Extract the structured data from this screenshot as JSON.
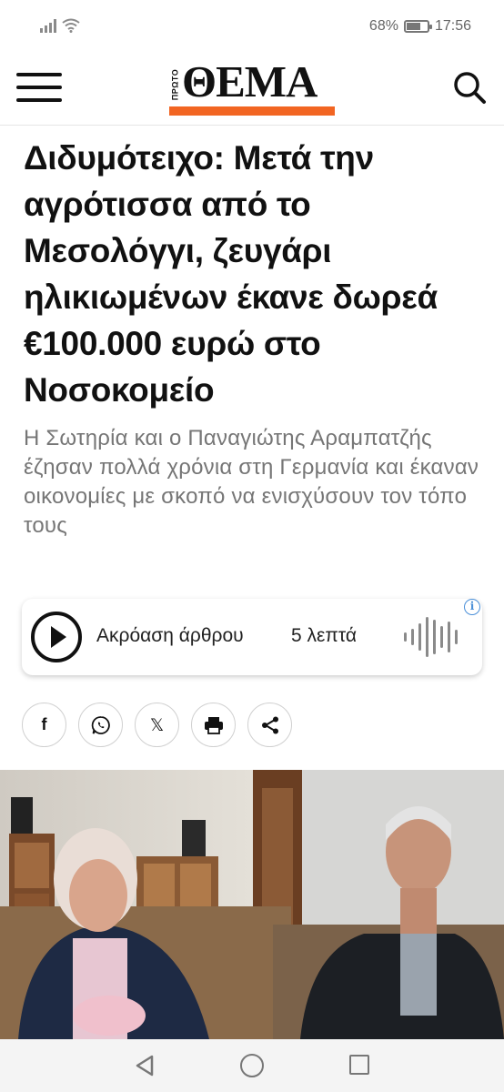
{
  "status_bar": {
    "battery_percent": "68%",
    "battery_level": 0.68,
    "time": "17:56",
    "icons": [
      "signal-icon",
      "wifi-icon",
      "battery-icon"
    ]
  },
  "header": {
    "logo_proto": "ΠΡΩΤΟ",
    "logo_text": "ΘΕΜΑ",
    "logo_accent": "#f26522",
    "icons": [
      "menu-icon",
      "search-icon"
    ]
  },
  "article": {
    "headline": "Διδυμότειχο: Μετά την αγρότισσα από το Μεσολόγγι, ζευγάρι ηλικιωμένων έκανε δωρεά €100.000 ευρώ στο Νοσοκομείο",
    "subheadline": "Η Σωτηρία και ο Παναγιώτης Αραμπατζής έζησαν πολλά χρόνια στη Γερμανία και έκαναν οικονομίες με σκοπό να ενισχύσουν τον τόπο τους"
  },
  "audio": {
    "label": "Ακρόαση άρθρου",
    "duration": "5 λεπτά",
    "info_symbol": "i",
    "icons": [
      "play-icon",
      "waveform-icon",
      "info-icon"
    ]
  },
  "share": {
    "buttons": [
      {
        "name": "facebook",
        "icon": "facebook-icon",
        "glyph": "f"
      },
      {
        "name": "whatsapp",
        "icon": "whatsapp-icon"
      },
      {
        "name": "x",
        "icon": "x-icon",
        "glyph": "𝕏"
      },
      {
        "name": "print",
        "icon": "print-icon"
      },
      {
        "name": "share",
        "icon": "share-icon"
      }
    ]
  },
  "navbar": {
    "icons": [
      "back-icon",
      "home-icon",
      "recents-icon"
    ]
  }
}
